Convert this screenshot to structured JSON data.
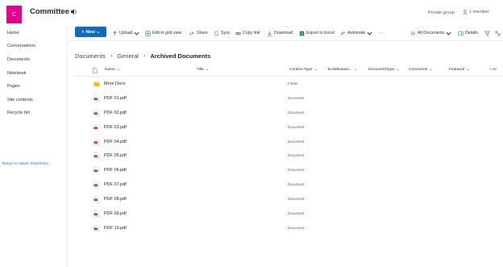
{
  "site": {
    "logo_letter": "C",
    "title": "Committee",
    "privacy": "Private group",
    "members": "1 member"
  },
  "nav": {
    "items": [
      "Home",
      "Conversations",
      "Documents",
      "Notebook",
      "Pages",
      "Site contents",
      "Recycle bin"
    ],
    "classic_link": "Return to classic SharePoint"
  },
  "toolbar": {
    "new": "New",
    "upload": "Upload",
    "grid": "Edit in grid view",
    "share": "Share",
    "sync": "Sync",
    "copy_link": "Copy link",
    "download": "Download",
    "export": "Export to Excel",
    "automate": "Automate",
    "more": "⋯",
    "view": "All Documents",
    "details": "Details"
  },
  "breadcrumb": [
    "Documents",
    "General",
    "Archived Documents"
  ],
  "columns": {
    "name": "Name",
    "title": "Title",
    "content_type": "Content Type",
    "eum": "EUMDataso...",
    "doc_type": "DocumentType",
    "comments": "Comments",
    "featured": "Featured",
    "add": "+ Ac"
  },
  "rows": [
    {
      "name": "More Docs",
      "type": "Folder",
      "icon": "folder-icon"
    },
    {
      "name": "PDF 01.pdf",
      "type": "Document",
      "icon": "pdf-icon"
    },
    {
      "name": "PDF 02.pdf",
      "type": "Document",
      "icon": "pdf-icon"
    },
    {
      "name": "PDF 03.pdf",
      "type": "Document",
      "icon": "pdf-icon"
    },
    {
      "name": "PDF 04.pdf",
      "type": "Document",
      "icon": "pdf-icon"
    },
    {
      "name": "PDF 05.pdf",
      "type": "Document",
      "icon": "pdf-icon"
    },
    {
      "name": "PDF 06.pdf",
      "type": "Document",
      "icon": "pdf-icon"
    },
    {
      "name": "PDF 07.pdf",
      "type": "Document",
      "icon": "pdf-icon"
    },
    {
      "name": "PDF 08.pdf",
      "type": "Document",
      "icon": "pdf-icon"
    },
    {
      "name": "PDF 09.pdf",
      "type": "Document",
      "icon": "pdf-icon"
    },
    {
      "name": "PDF 10.pdf",
      "type": "Document",
      "icon": "pdf-icon"
    }
  ],
  "colors": {
    "brand": "#e3008c",
    "accent": "#0f6cbd",
    "pdf": "#d13438",
    "folder": "#ffb900"
  }
}
